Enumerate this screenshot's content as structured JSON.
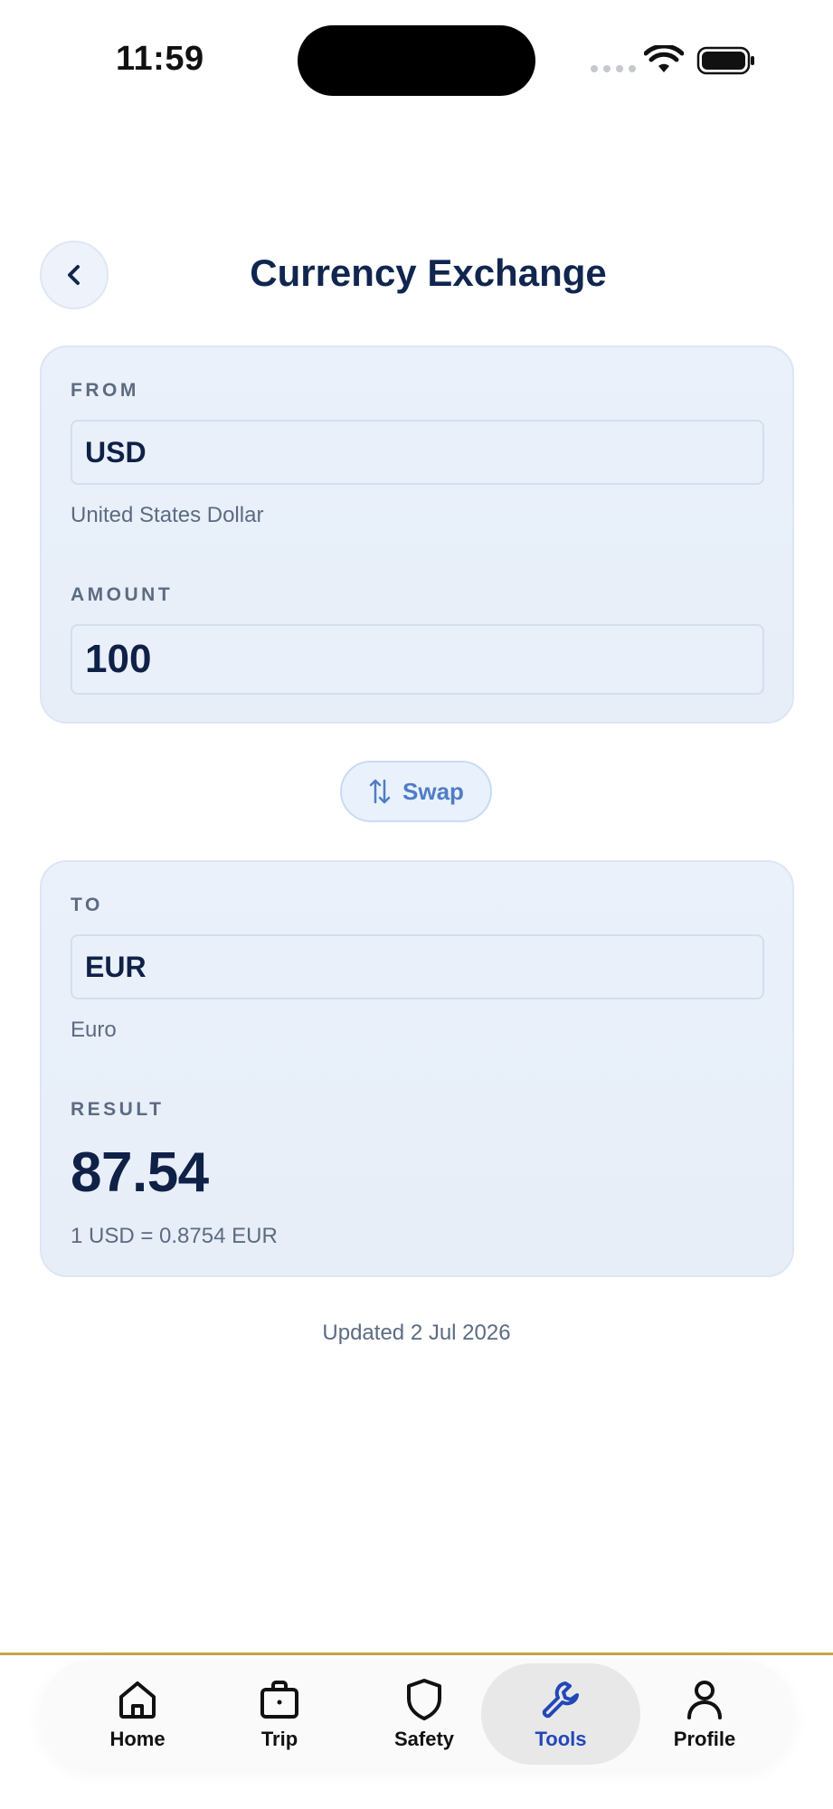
{
  "status_bar": {
    "time": "11:59"
  },
  "header": {
    "title": "Currency Exchange"
  },
  "from": {
    "label": "FROM",
    "currency_code": "USD",
    "currency_name": "United States Dollar",
    "amount_label": "AMOUNT",
    "amount_value": "100"
  },
  "swap": {
    "label": "Swap"
  },
  "to": {
    "label": "TO",
    "currency_code": "EUR",
    "currency_name": "Euro",
    "result_label": "RESULT",
    "result_value": "87.54",
    "rate_text": "1 USD = 0.8754 EUR"
  },
  "updated": "Updated 2 Jul 2026",
  "nav": {
    "items": [
      {
        "label": "Home",
        "icon": "home-icon"
      },
      {
        "label": "Trip",
        "icon": "briefcase-icon"
      },
      {
        "label": "Safety",
        "icon": "shield-icon"
      },
      {
        "label": "Tools",
        "icon": "wrench-icon",
        "active": true
      },
      {
        "label": "Profile",
        "icon": "person-icon"
      }
    ]
  },
  "colors": {
    "primary_text": "#0f2147",
    "active_nav": "#2247b8",
    "accent_divider": "#c9a24a",
    "swap_accent": "#4f7cc5"
  }
}
